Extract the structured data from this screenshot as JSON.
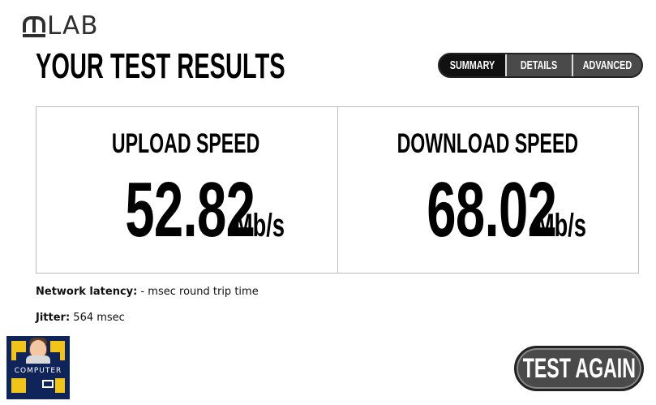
{
  "logo": {
    "text": "LAB"
  },
  "page_title": "YOUR TEST RESULTS",
  "tabs": [
    {
      "label": "SUMMARY",
      "active": true
    },
    {
      "label": "DETAILS",
      "active": false
    },
    {
      "label": "ADVANCED",
      "active": false
    }
  ],
  "upload": {
    "label": "UPLOAD SPEED",
    "value": "52.82",
    "unit": "Mb/s"
  },
  "download": {
    "label": "DOWNLOAD SPEED",
    "value": "68.02",
    "unit": "Mb/s"
  },
  "latency": {
    "label": "Network latency:",
    "value": "- msec round trip time"
  },
  "jitter": {
    "label": "Jitter:",
    "value": "564 msec"
  },
  "badge": {
    "text": "COMPUTER"
  },
  "test_again": "TEST AGAIN",
  "colors": {
    "badge_bg": "#0f2458",
    "badge_accent": "#f0c419",
    "button_bg": "#4a4a4a"
  }
}
